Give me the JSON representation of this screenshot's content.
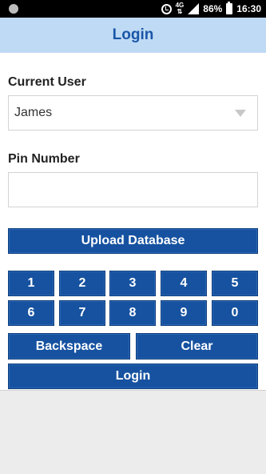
{
  "status": {
    "network": "4G",
    "battery": "86%",
    "time": "16:30"
  },
  "appbar": {
    "title": "Login"
  },
  "form": {
    "user_label": "Current User",
    "user_value": "James",
    "pin_label": "Pin Number",
    "pin_value": "",
    "upload_label": "Upload Database"
  },
  "keypad": {
    "digits": [
      "1",
      "2",
      "3",
      "4",
      "5",
      "6",
      "7",
      "8",
      "9",
      "0"
    ],
    "backspace_label": "Backspace",
    "clear_label": "Clear",
    "login_label": "Login"
  },
  "colors": {
    "accent": "#1652a0",
    "appbar_bg": "#bfdaf4",
    "title_color": "#1a56a8"
  }
}
